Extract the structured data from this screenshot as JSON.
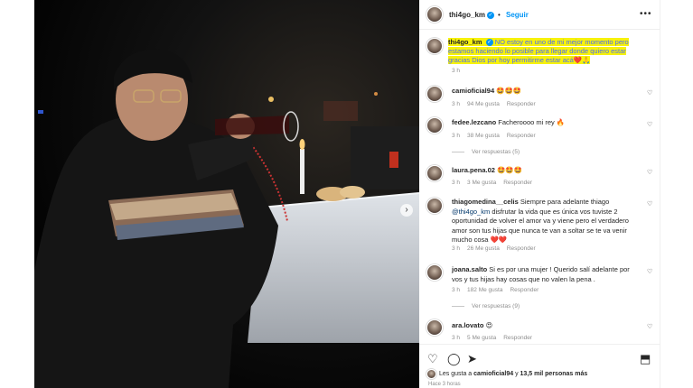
{
  "post": {
    "author": "thi4go_km",
    "follow_label": "Seguir",
    "separator": "•",
    "more_label": "•••",
    "verified_mark": "✓",
    "caption_text": "NO estoy en uno de mi mejor momento pero estamos haciendo lo posible para llegar donde quiero estar gracias Dios por hoy permitirme estar acá❤️🙏",
    "caption_time": "3 h",
    "next_arrow": "›"
  },
  "comments": [
    {
      "user": "camioficial94",
      "text": "🤩🤩🤩",
      "time": "3 h",
      "likes": "94 Me gusta",
      "reply": "Responder"
    },
    {
      "user": "fedee.lezcano",
      "text": "Facheroooo mi rey 🔥",
      "time": "3 h",
      "likes": "38 Me gusta",
      "reply": "Responder",
      "replies": "Ver respuestas (5)"
    },
    {
      "user": "laura.pena.02",
      "text": "🤩🤩🤩",
      "time": "3 h",
      "likes": "3 Me gusta",
      "reply": "Responder"
    },
    {
      "user": "thiagomedina__celis",
      "text": "Siempre para adelante thiago",
      "mention": "@thi4go_km",
      "text2": "disfrutar la vida que es única vos tuviste 2 oportunidad de volver el amor va y viene pero el verdadero amor son tus hijas que nunca te van a soltar se te va venir mucho cosa ❤️❤️",
      "time": "3 h",
      "likes": "26 Me gusta",
      "reply": "Responder"
    },
    {
      "user": "joana.salto",
      "text": "Si es por una mujer ! Querido salí adelante por vos y tus hijas hay cosas que no valen la pena .",
      "time": "3 h",
      "likes": "182 Me gusta",
      "reply": "Responder",
      "replies": "Ver respuestas (9)"
    },
    {
      "user": "ara.lovato",
      "text": "😍",
      "time": "3 h",
      "likes": "5 Me gusta",
      "reply": "Responder"
    }
  ],
  "heart_icon": "♡",
  "actions": {
    "like": "♡",
    "comment": "◯",
    "share": "➤",
    "save": "⬒"
  },
  "likes_summary": {
    "prefix": "Les gusta a",
    "user": "camioficial94",
    "middle": "y",
    "count": "13,5 mil personas más"
  },
  "posted_ago": "Hace 3 horas"
}
